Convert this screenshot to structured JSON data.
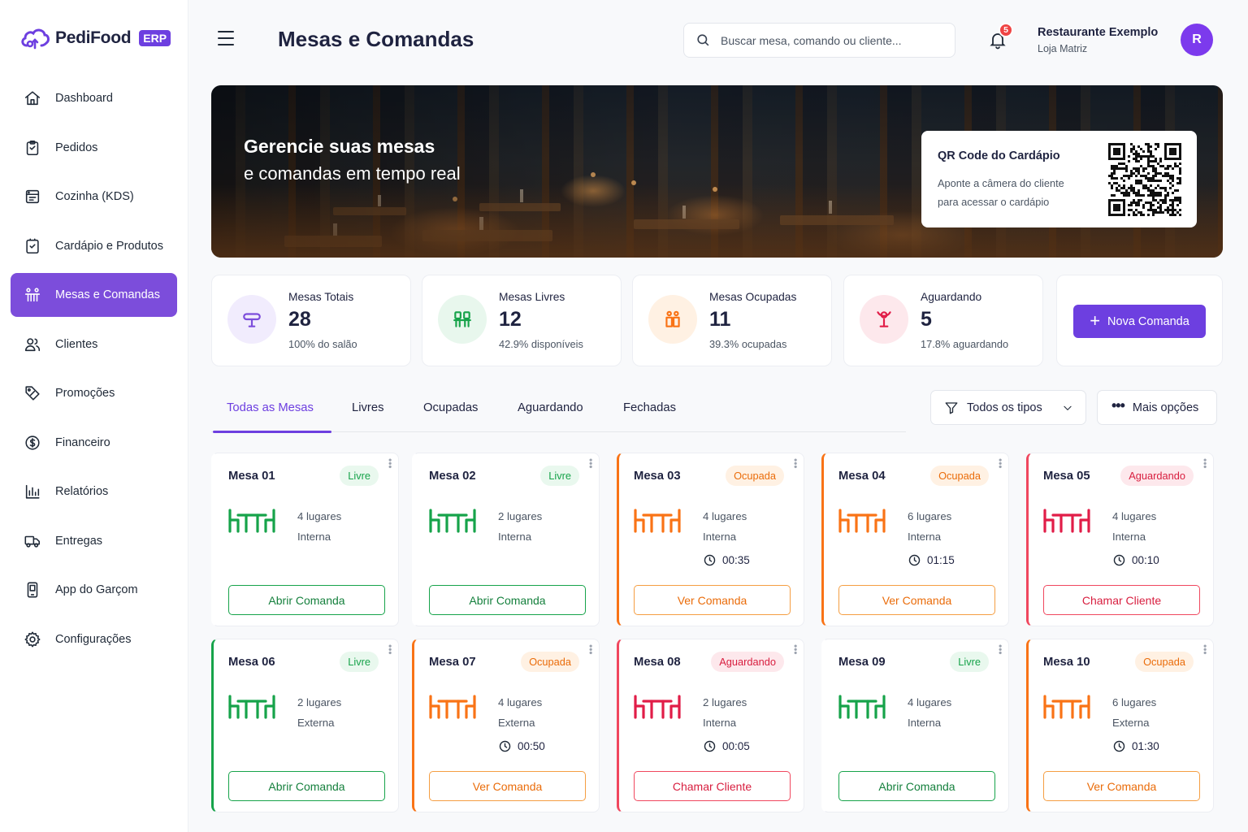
{
  "brand": {
    "name": "PediFood",
    "badge": "ERP"
  },
  "sidebar": {
    "items": [
      {
        "label": "Dashboard",
        "icon": "home-icon"
      },
      {
        "label": "Pedidos",
        "icon": "clipboard-icon"
      },
      {
        "label": "Cozinha (KDS)",
        "icon": "kitchen-icon"
      },
      {
        "label": "Cardápio e Produtos",
        "icon": "menu-book-icon"
      },
      {
        "label": "Mesas e Comandas",
        "icon": "tables-icon",
        "active": true
      },
      {
        "label": "Clientes",
        "icon": "users-icon"
      },
      {
        "label": "Promoções",
        "icon": "tag-icon"
      },
      {
        "label": "Financeiro",
        "icon": "dollar-icon"
      },
      {
        "label": "Relatórios",
        "icon": "bar-chart-icon"
      },
      {
        "label": "Entregas",
        "icon": "truck-icon"
      },
      {
        "label": "App do Garçom",
        "icon": "phone-icon"
      },
      {
        "label": "Configurações",
        "icon": "gear-icon"
      }
    ]
  },
  "header": {
    "title": "Mesas e Comandas",
    "search_placeholder": "Buscar mesa, comando ou cliente...",
    "notifications": "5",
    "restaurant_name": "Restaurante Exemplo",
    "store_name": "Loja Matriz",
    "avatar_initial": "R"
  },
  "banner": {
    "title": "Gerencie suas mesas",
    "subtitle": "e comandas em tempo real",
    "qr_title": "QR Code do Cardápio",
    "qr_text": "Aponte a câmera do cliente para acessar o cardápio"
  },
  "stats": [
    {
      "label": "Mesas Totais",
      "value": "28",
      "sub": "100% do salão",
      "color": "#7c4ddb",
      "bg": "#f1ecfd",
      "icon": "table-icon"
    },
    {
      "label": "Mesas Livres",
      "value": "12",
      "sub": "42.9% disponíveis",
      "color": "#16a34a",
      "bg": "#e8f7ed",
      "icon": "chairs-icon"
    },
    {
      "label": "Mesas Ocupadas",
      "value": "11",
      "sub": "39.3% ocupadas",
      "color": "#f97316",
      "bg": "#fff1e3",
      "icon": "people-icon"
    },
    {
      "label": "Aguardando",
      "value": "5",
      "sub": "17.8% aguardando",
      "color": "#e11d48",
      "bg": "#fde8ec",
      "icon": "waiting-icon"
    }
  ],
  "new_order_label": "Nova Comanda",
  "tabs": [
    "Todas as Mesas",
    "Livres",
    "Ocupadas",
    "Aguardando",
    "Fechadas"
  ],
  "filter_label": "Todos os tipos",
  "more_label": "Mais opções",
  "tables": [
    {
      "name": "Mesa 01",
      "status": "Livre",
      "type": "livre",
      "seats": "4 lugares",
      "zone": "Interna",
      "timer": "",
      "action": "Abrir Comanda"
    },
    {
      "name": "Mesa 02",
      "status": "Livre",
      "type": "livre",
      "seats": "2 lugares",
      "zone": "Interna",
      "timer": "",
      "action": "Abrir Comanda"
    },
    {
      "name": "Mesa 03",
      "status": "Ocupada",
      "type": "ocupada",
      "seats": "4 lugares",
      "zone": "Interna",
      "timer": "00:35",
      "action": "Ver Comanda"
    },
    {
      "name": "Mesa 04",
      "status": "Ocupada",
      "type": "ocupada",
      "seats": "6 lugares",
      "zone": "Interna",
      "timer": "01:15",
      "action": "Ver Comanda"
    },
    {
      "name": "Mesa 05",
      "status": "Aguardando",
      "type": "aguardando",
      "seats": "4 lugares",
      "zone": "Interna",
      "timer": "00:10",
      "action": "Chamar Cliente"
    },
    {
      "name": "Mesa 06",
      "status": "Livre",
      "type": "livre",
      "seats": "2 lugares",
      "zone": "Externa",
      "timer": "",
      "action": "Abrir Comanda"
    },
    {
      "name": "Mesa 07",
      "status": "Ocupada",
      "type": "ocupada",
      "seats": "4 lugares",
      "zone": "Externa",
      "timer": "00:50",
      "action": "Ver Comanda"
    },
    {
      "name": "Mesa 08",
      "status": "Aguardando",
      "type": "aguardando",
      "seats": "2 lugares",
      "zone": "Interna",
      "timer": "00:05",
      "action": "Chamar Cliente"
    },
    {
      "name": "Mesa 09",
      "status": "Livre",
      "type": "livre",
      "seats": "4 lugares",
      "zone": "Interna",
      "timer": "",
      "action": "Abrir Comanda"
    },
    {
      "name": "Mesa 10",
      "status": "Ocupada",
      "type": "ocupada",
      "seats": "6 lugares",
      "zone": "Externa",
      "timer": "01:30",
      "action": "Ver Comanda"
    }
  ],
  "colors": {
    "accent": "#6d3fe0",
    "livre": "#16a34a",
    "ocupada": "#f97316",
    "aguardando": "#e11d48"
  }
}
